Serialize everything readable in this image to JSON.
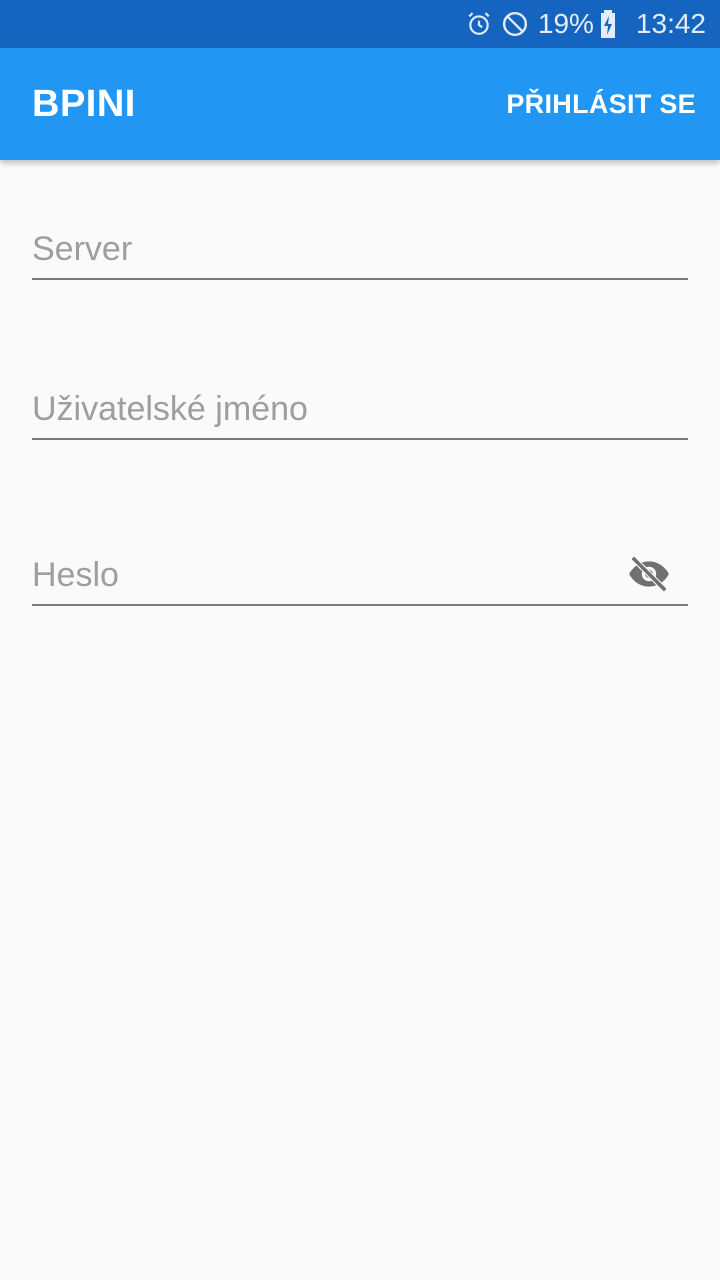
{
  "status_bar": {
    "battery_percent": "19%",
    "time": "13:42",
    "icons": [
      "alarm-icon",
      "do-not-disturb-icon",
      "battery-charging-icon"
    ]
  },
  "app_bar": {
    "title": "BPINI",
    "action_label": "PŘIHLÁSIT SE",
    "color": "#2196f3",
    "status_color": "#1565c0"
  },
  "form": {
    "server": {
      "placeholder": "Server",
      "value": ""
    },
    "username": {
      "placeholder": "Uživatelské jméno",
      "value": ""
    },
    "password": {
      "placeholder": "Heslo",
      "value": "",
      "toggle_icon": "visibility-off-icon"
    }
  }
}
